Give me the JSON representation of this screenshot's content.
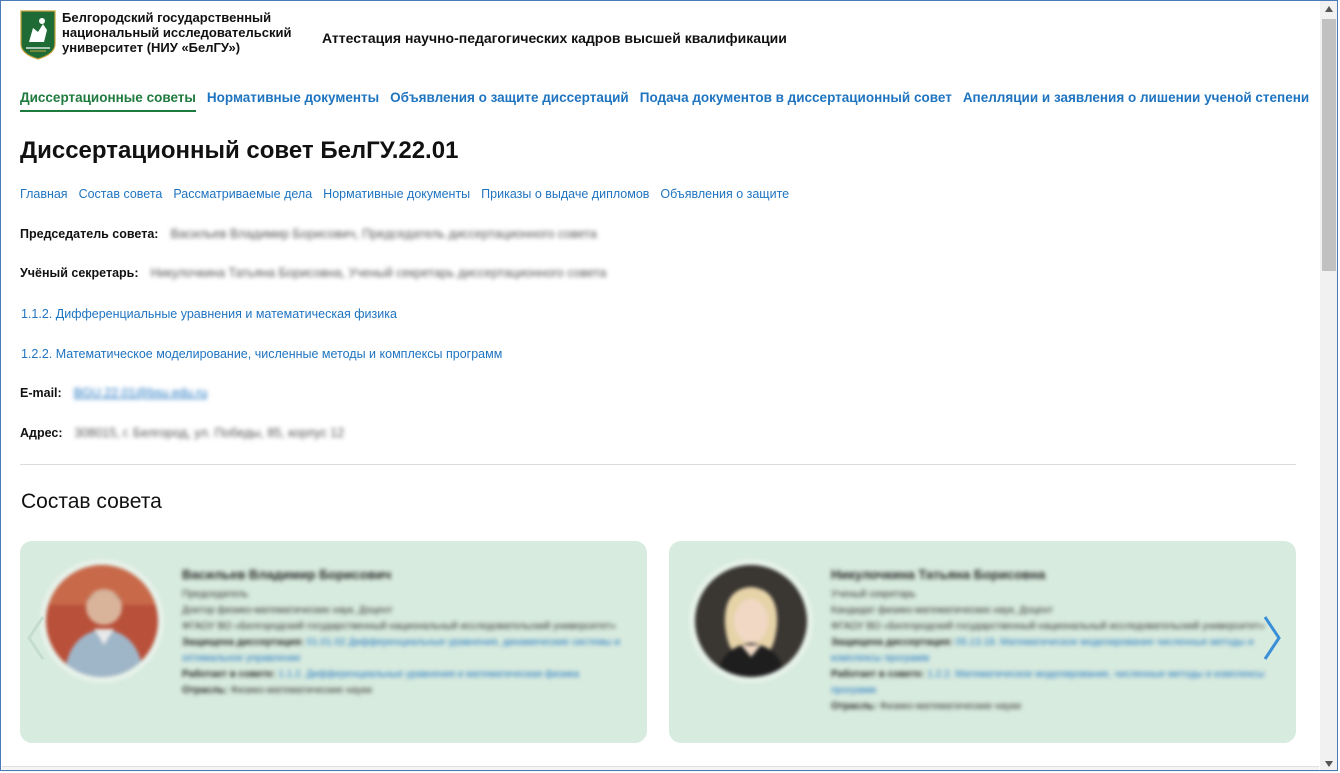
{
  "header": {
    "university_lines": [
      "Белгородский государственный",
      "национальный исследовательский",
      "университет (НИУ «БелГУ»)"
    ],
    "site_title": "Аттестация научно-педагогических кадров высшей квалификации"
  },
  "main_nav": [
    {
      "label": "Диссертационные советы",
      "active": true
    },
    {
      "label": "Нормативные документы",
      "active": false
    },
    {
      "label": "Объявления о защите диссертаций",
      "active": false
    },
    {
      "label": "Подача документов в диссертационный совет",
      "active": false
    },
    {
      "label": "Апелляции и заявления о лишении ученой степени",
      "active": false
    }
  ],
  "page_title": "Диссертационный совет БелГУ.22.01",
  "sub_nav": [
    "Главная",
    "Состав совета",
    "Рассматриваемые дела",
    "Нормативные документы",
    "Приказы о выдаче дипломов",
    "Объявления о защите"
  ],
  "info": {
    "chair_label": "Председатель совета:",
    "chair_value": "Васильев Владимир Борисович, Председатель диссертационного совета",
    "secretary_label": "Учёный секретарь:",
    "secretary_value": "Никулочкина Татьяна Борисовна, Ученый секретарь диссертационного совета",
    "specialties": [
      "1.1.2. Дифференциальные уравнения и математическая физика",
      "1.2.2. Математическое моделирование, численные методы и комплексы программ"
    ],
    "email_label": "E-mail:",
    "email_value": "BGU.22.01@bsu.edu.ru",
    "address_label": "Адрес:",
    "address_value": "308015, г. Белгород, ул. Победы, 85, корпус 12"
  },
  "council_section_title": "Состав совета",
  "members": [
    {
      "name": "Васильев Владимир Борисович",
      "role": "Председатель",
      "degree": "Доктор физико-математических наук, Доцент",
      "org": "ФГАОУ ВО «Белгородский государственный национальный исследовательский университет»",
      "defended_label": "Защищена диссертация:",
      "defended_value": "01.01.02 Дифференциальные уравнения, динамические системы и оптимальное управление",
      "works_label": "Работает в совете:",
      "works_value": "1.1.2. Дифференциальные уравнения и математическая физика",
      "field_label": "Отрасль:",
      "field_value": "Физико-математические науки"
    },
    {
      "name": "Никулочкина Татьяна Борисовна",
      "role": "Ученый секретарь",
      "degree": "Кандидат физико-математических наук, Доцент",
      "org": "ФГАОУ ВО «Белгородский государственный национальный исследовательский университет»",
      "defended_label": "Защищена диссертация:",
      "defended_value": "05.13.18. Математическое моделирование численные методы и комплексы программ",
      "works_label": "Работает в совете:",
      "works_value": "1.2.2. Математическое моделирование, численные методы и комплексы программ",
      "field_label": "Отрасль:",
      "field_value": "Физико-математические науки"
    }
  ],
  "colors": {
    "link": "#1f74c0",
    "active": "#1f7a3e",
    "card_bg": "#d8ebdf",
    "logo_green": "#1e6b35"
  },
  "icons": [
    "university-logo",
    "chevron-left-icon",
    "chevron-right-icon",
    "scroll-up-icon",
    "scroll-down-icon"
  ]
}
